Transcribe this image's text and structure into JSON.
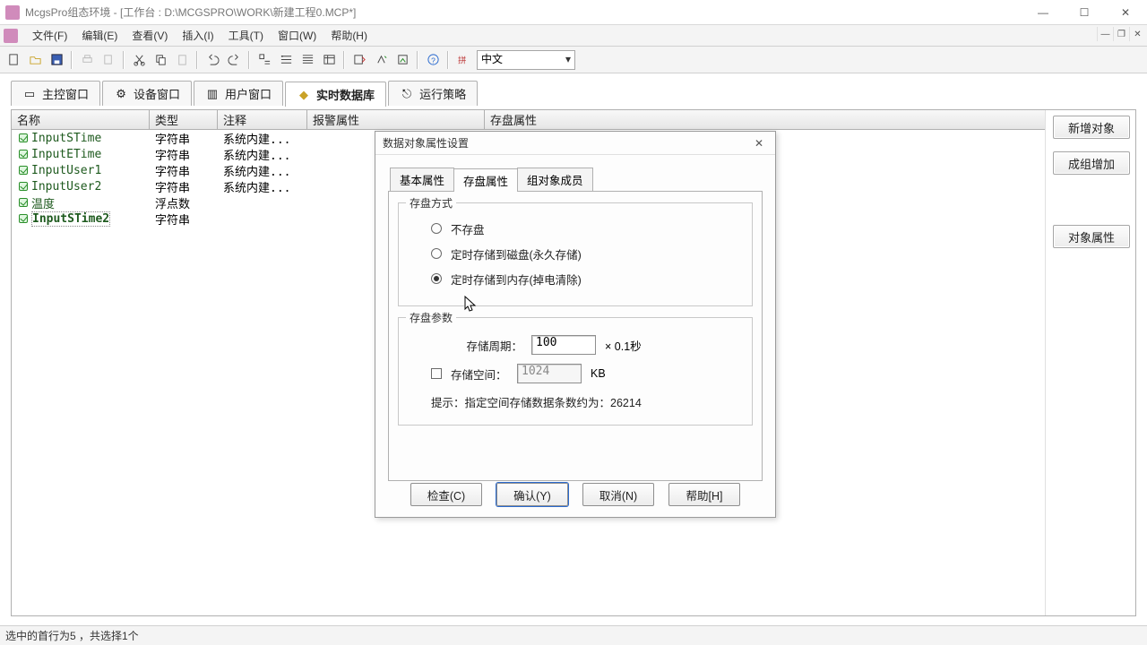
{
  "window": {
    "title": "McgsPro组态环境 - [工作台 : D:\\MCGSPRO\\WORK\\新建工程0.MCP*]"
  },
  "menubar": {
    "file": "文件(F)",
    "edit": "编辑(E)",
    "view": "查看(V)",
    "insert": "插入(I)",
    "tool": "工具(T)",
    "window": "窗口(W)",
    "help": "帮助(H)"
  },
  "toolbar": {
    "language": "中文"
  },
  "tabs": {
    "main": "主控窗口",
    "device": "设备窗口",
    "user": "用户窗口",
    "rtdb": "实时数据库",
    "strategy": "运行策略"
  },
  "grid": {
    "headers": {
      "name": "名称",
      "type": "类型",
      "comment": "注释",
      "alarm": "报警属性",
      "save": "存盘属性"
    },
    "colw": {
      "name": 154,
      "type": 76,
      "comment": 100,
      "alarm": 198,
      "save": 150
    },
    "rows": [
      {
        "name": "InputSTime",
        "type": "字符串",
        "comment": "系统内建..."
      },
      {
        "name": "InputETime",
        "type": "字符串",
        "comment": "系统内建..."
      },
      {
        "name": "InputUser1",
        "type": "字符串",
        "comment": "系统内建..."
      },
      {
        "name": "InputUser2",
        "type": "字符串",
        "comment": "系统内建..."
      },
      {
        "name": "温度",
        "type": "浮点数",
        "comment": ""
      },
      {
        "name": "InputSTime2",
        "type": "字符串",
        "comment": ""
      }
    ],
    "selected_index": 5
  },
  "sidebtns": {
    "newobj": "新增对象",
    "group": "成组增加",
    "prop": "对象属性"
  },
  "dialog": {
    "title": "数据对象属性设置",
    "tabs": {
      "basic": "基本属性",
      "save": "存盘属性",
      "group": "组对象成员"
    },
    "active_tab": "save",
    "save": {
      "mode_legend": "存盘方式",
      "opt_no": "不存盘",
      "opt_disk": "定时存储到磁盘(永久存储)",
      "opt_mem": "定时存储到内存(掉电清除)",
      "selected": "mem",
      "param_legend": "存盘参数",
      "period_label": "存储周期：",
      "period_value": "100",
      "period_unit": "× 0.1秒",
      "space_checked": false,
      "space_label": "存储空间：",
      "space_value": "1024",
      "space_unit": "KB",
      "hint_prefix": "提示：指定空间存储数据条数约为：",
      "hint_count": "26214"
    },
    "buttons": {
      "check": "检查(C)",
      "ok": "确认(Y)",
      "cancel": "取消(N)",
      "help": "帮助[H]"
    }
  },
  "statusbar": {
    "text": "选中的首行为5 ，共选择1个"
  }
}
